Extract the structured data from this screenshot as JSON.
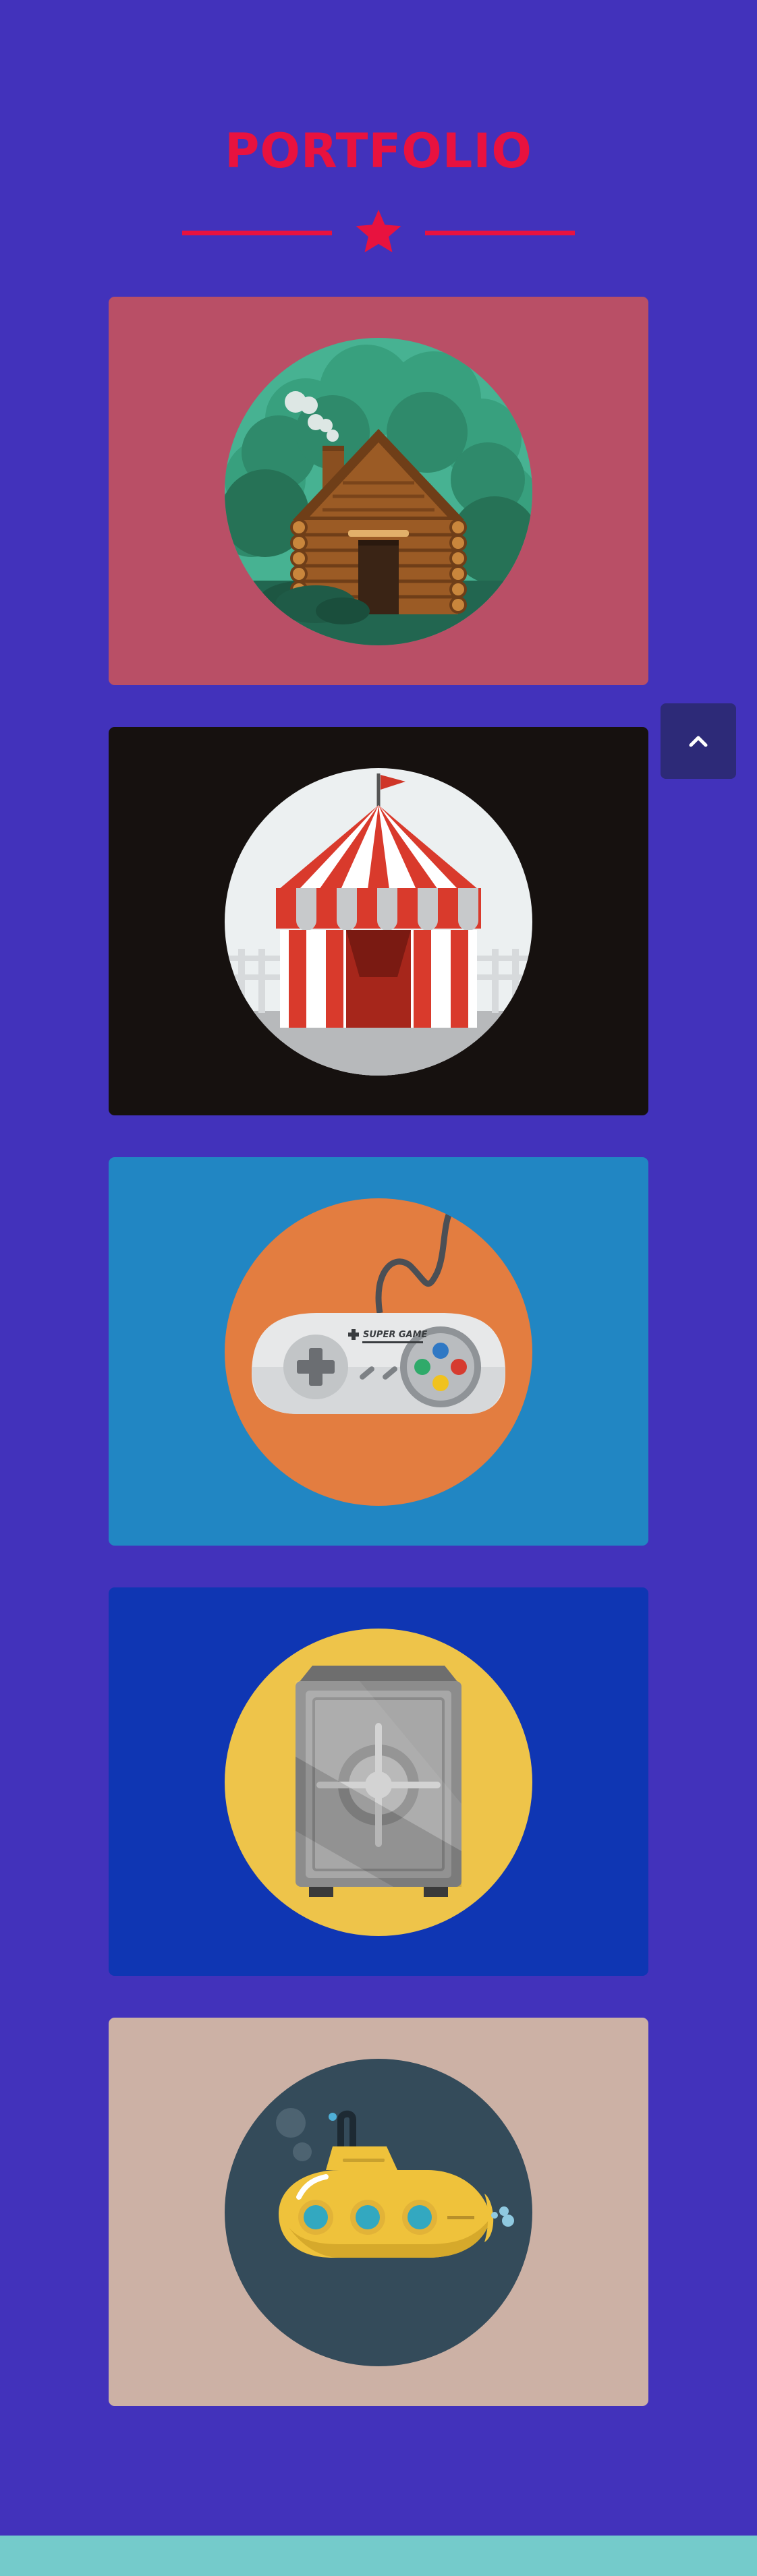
{
  "section": {
    "title": "PORTFOLIO",
    "accent_color": "#e8123f",
    "background_color": "#4232bb",
    "divider_icon": "star-icon"
  },
  "portfolio": {
    "items": [
      {
        "name": "log-cabin",
        "icon": "log-cabin-icon",
        "card_color": "#b94f66",
        "circle_color": "#47b292"
      },
      {
        "name": "circus-tent",
        "icon": "circus-tent-icon",
        "card_color": "#16110f",
        "circle_color": "#ecf0f1"
      },
      {
        "name": "game-controller",
        "icon": "game-controller-icon",
        "card_color": "#2186c3",
        "circle_color": "#e37d40",
        "controller_text": "SUPER GAME"
      },
      {
        "name": "safe",
        "icon": "safe-icon",
        "card_color": "#0f36b3",
        "circle_color": "#eec44a"
      },
      {
        "name": "submarine",
        "icon": "submarine-icon",
        "card_color": "#ccb1a5",
        "circle_color": "#344b5a"
      }
    ]
  },
  "scroll_top": {
    "icon": "chevron-up-icon",
    "color": "#2d2a78"
  },
  "footer": {
    "color": "#74cbcb"
  }
}
